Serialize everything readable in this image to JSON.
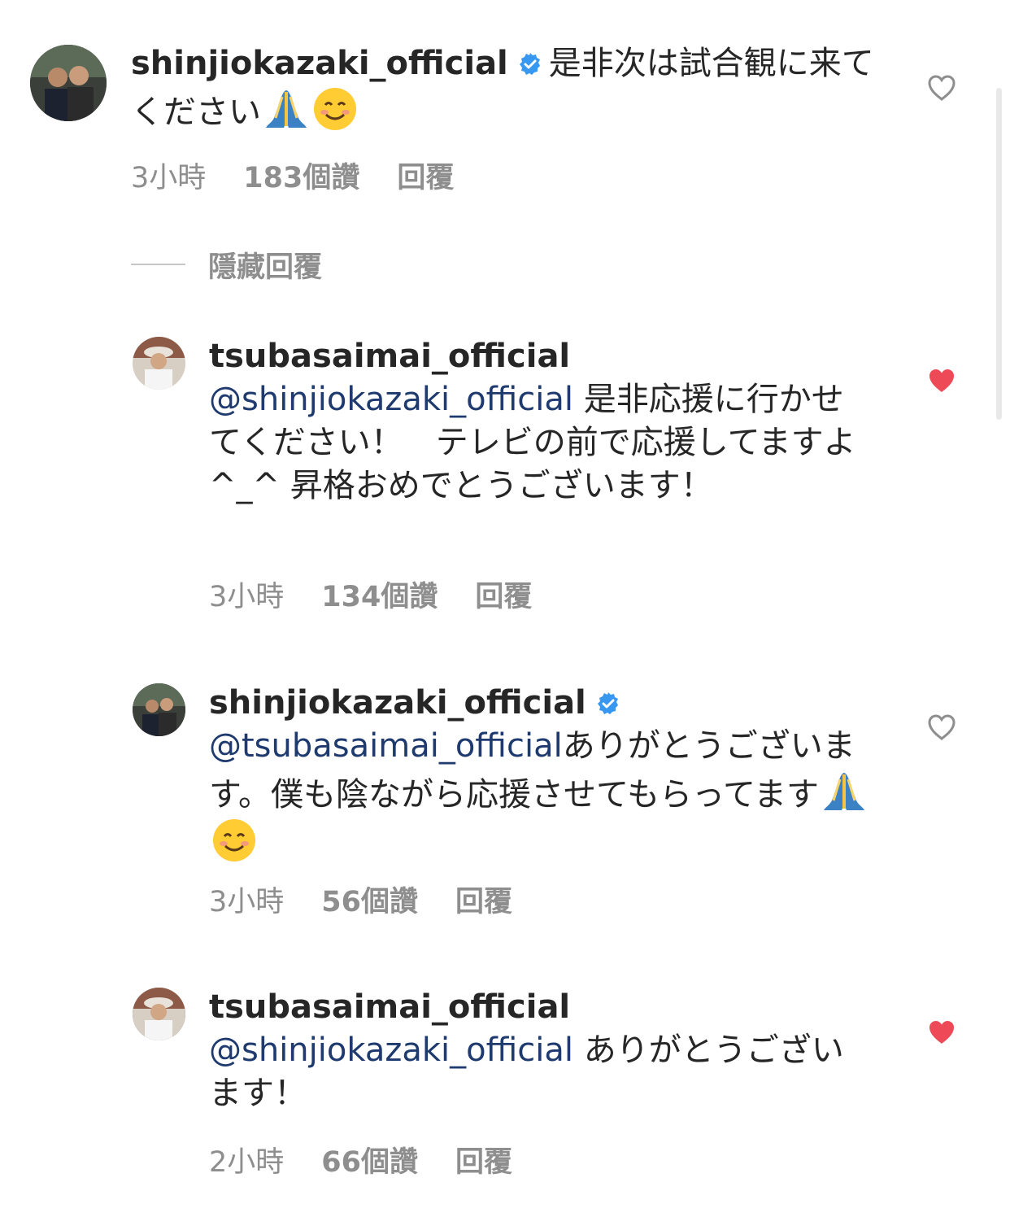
{
  "colors": {
    "heart_liked": "#ed4956",
    "verified": "#3897f0",
    "mention": "#1e3a6e",
    "meta": "#8e8e8e"
  },
  "comments": [
    {
      "username": "shinjiokazaki_official",
      "verified": true,
      "mention": "",
      "text_before_emoji": "是非次は試合観に来てください",
      "emojis": [
        "folded-hands",
        "smiling-face"
      ],
      "time": "3小時",
      "likes": "183個讚",
      "reply_label": "回覆",
      "liked": false
    },
    {
      "username": "tsubasaimai_official",
      "verified": false,
      "mention": "@shinjiokazaki_official",
      "text_before_emoji": " 是非応援に行かせてください！　テレビの前で応援してますよ^_^ 昇格おめでとうございます！",
      "emojis": [],
      "time": "3小時",
      "likes": "134個讚",
      "reply_label": "回覆",
      "liked": true
    },
    {
      "username": "shinjiokazaki_official",
      "verified": true,
      "mention": "@tsubasaimai_official",
      "text_before_emoji": "ありがとうございます。僕も陰ながら応援させてもらってます",
      "emojis": [
        "folded-hands",
        "smiling-face"
      ],
      "time": "3小時",
      "likes": "56個讚",
      "reply_label": "回覆",
      "liked": false
    },
    {
      "username": "tsubasaimai_official",
      "verified": false,
      "mention": "@shinjiokazaki_official",
      "text_before_emoji": " ありがとうございます！",
      "emojis": [],
      "time": "2小時",
      "likes": "66個讚",
      "reply_label": "回覆",
      "liked": true
    }
  ],
  "hide_replies_label": "隱藏回覆"
}
